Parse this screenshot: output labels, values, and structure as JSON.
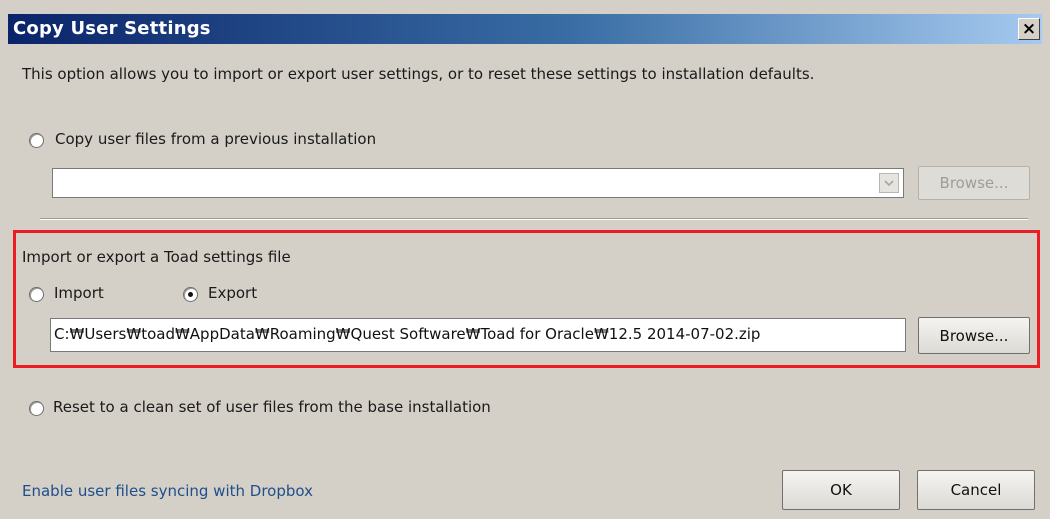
{
  "window": {
    "title": "Copy User Settings",
    "close_label": "×"
  },
  "description": "This option allows you to import or export user settings, or to reset these settings to installation defaults.",
  "copy_option": {
    "label": "Copy user files from a previous installation",
    "selected": false,
    "combo_value": "",
    "browse_label": "Browse...",
    "browse_enabled": false
  },
  "import_export": {
    "heading": "Import or export a Toad settings file",
    "import_label": "Import",
    "export_label": "Export",
    "selected": "Export",
    "path_value": "C:₩Users₩toad₩AppData₩Roaming₩Quest Software₩Toad for Oracle₩12.5 2014-07-02.zip",
    "browse_label": "Browse..."
  },
  "reset_option": {
    "label": "Reset to a clean set of user files from the base installation",
    "selected": false
  },
  "footer": {
    "dropbox_link": "Enable user files syncing with Dropbox",
    "ok_label": "OK",
    "cancel_label": "Cancel"
  },
  "colors": {
    "title_gradient_start": "#0a246a",
    "title_gradient_end": "#a6caf0",
    "dialog_bg": "#d4d0c8",
    "highlight_border": "#ed1c24",
    "link": "#1f4e8c"
  }
}
